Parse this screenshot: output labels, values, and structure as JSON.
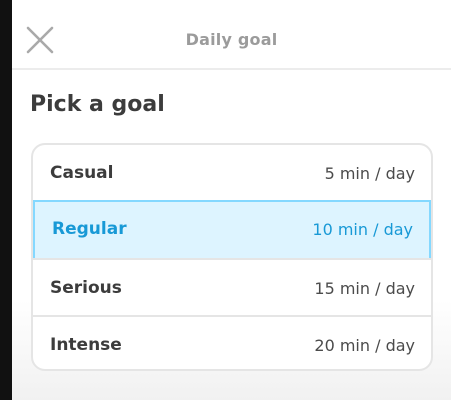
{
  "header": {
    "title": "Daily goal",
    "close_icon": "close-icon"
  },
  "heading": "Pick a goal",
  "goals": [
    {
      "name": "Casual",
      "time": "5 min / day",
      "selected": false
    },
    {
      "name": "Regular",
      "time": "10 min / day",
      "selected": true
    },
    {
      "name": "Serious",
      "time": "15 min / day",
      "selected": false
    },
    {
      "name": "Intense",
      "time": "20 min / day",
      "selected": false
    }
  ],
  "colors": {
    "selected_text": "#1899d6",
    "selected_background": "#ddf4ff",
    "selected_border": "#84d8ff"
  }
}
